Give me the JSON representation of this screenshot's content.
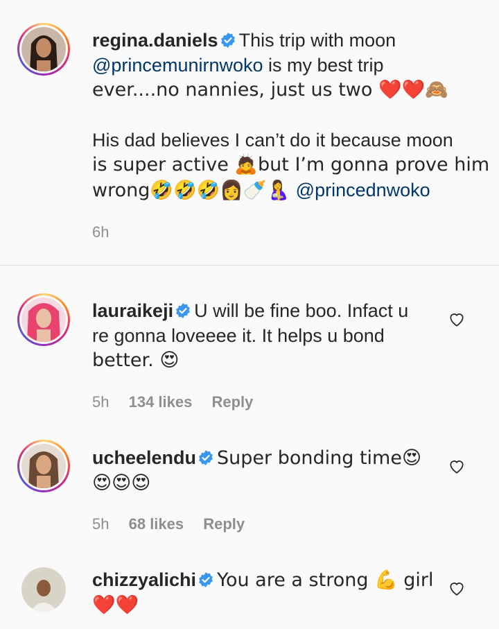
{
  "caption": {
    "username": "regina.daniels",
    "lines": [
      "This trip with moon",
      "@princemunirnwoko",
      " is my best trip",
      "ever....no nannies, just us two ❤️❤️🙈",
      "His dad believes I can’t do it because moon",
      "is super active 🙇but I’m gonna prove him",
      "wrong🤣🤣🤣👩🍼🤱 ",
      "@princednwoko"
    ],
    "time": "6h"
  },
  "comments": [
    {
      "username": "lauraikeji",
      "lines": [
        "U will be fine boo. Infact u",
        "re gonna loveeee it. It helps u bond",
        "better. 😍"
      ],
      "time": "5h",
      "likes": "134 likes",
      "reply": "Reply"
    },
    {
      "username": "ucheelendu",
      "lines": [
        "Super bonding time😍",
        "😍😍😍"
      ],
      "time": "5h",
      "likes": "68 likes",
      "reply": "Reply"
    },
    {
      "username": "chizzyalichi",
      "lines": [
        "You are a strong 💪 girl",
        "❤️❤️"
      ]
    }
  ],
  "colors": {
    "verified": "#3897f0",
    "mention": "#00376b",
    "meta": "#8e8e8e",
    "background": "#fafafa"
  }
}
